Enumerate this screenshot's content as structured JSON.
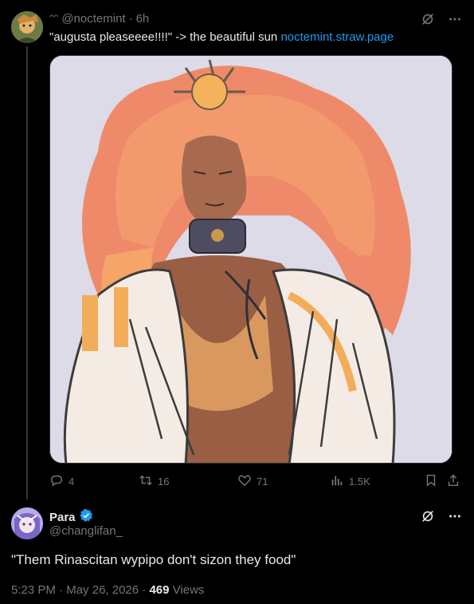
{
  "tweet": {
    "header_prefix": "ᵔᵔ",
    "handle": "@noctemint",
    "separator": "·",
    "time": "6h",
    "text": "\"augusta pleaseeee!!!!\" -> the beautiful sun ",
    "link": "noctemint.straw.page",
    "actions": {
      "replies": "4",
      "retweets": "16",
      "likes": "71",
      "views": "1.5K"
    }
  },
  "reply": {
    "name": "Para",
    "handle": "@changlifan_",
    "text": "\"Them Rinascitan wypipo don't sizon they food\"",
    "time": "5:23 PM",
    "date": "May 26, 2026",
    "separator1": "·",
    "separator2": "·",
    "views_count": "469",
    "views_label": "Views"
  },
  "colors": {
    "accent": "#1d9bf0",
    "muted": "#71767b",
    "text": "#e7e9ea",
    "background": "#000000"
  },
  "icons": [
    "grok-icon",
    "more-icon",
    "reply-icon",
    "retweet-icon",
    "like-icon",
    "views-icon",
    "bookmark-icon",
    "share-icon",
    "verified-badge-icon"
  ]
}
